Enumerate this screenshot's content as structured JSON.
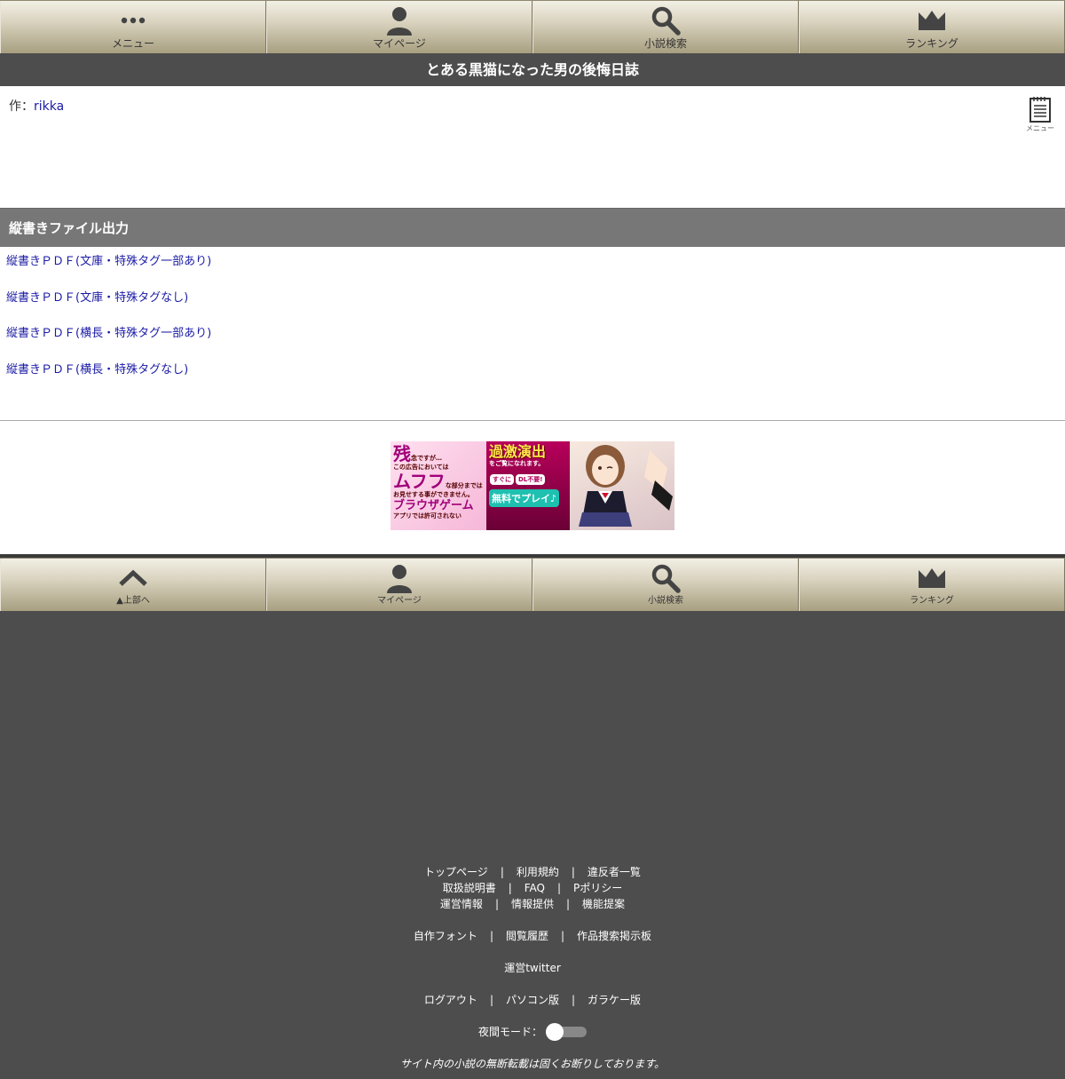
{
  "top_nav": [
    {
      "label": "メニュー",
      "icon": "dots-icon"
    },
    {
      "label": "マイページ",
      "icon": "user-icon"
    },
    {
      "label": "小説検索",
      "icon": "search-icon"
    },
    {
      "label": "ランキング",
      "icon": "crown-icon"
    }
  ],
  "title": "とある黒猫になった男の後悔日誌",
  "author": {
    "prefix": "作：",
    "name": "rikka"
  },
  "menu_button": {
    "label": "メニュー"
  },
  "section_header": "縦書きファイル出力",
  "pdf_links": [
    "縦書きＰＤＦ(文庫・特殊タグ一部あり)",
    "縦書きＰＤＦ(文庫・特殊タグなし)",
    "縦書きＰＤＦ(横長・特殊タグ一部あり)",
    "縦書きＰＤＦ(横長・特殊タグなし)"
  ],
  "ad": {
    "left_big1": "残",
    "left_small1": "念ですが…",
    "left_small2": "この広告においては",
    "left_big2": "ムフフ",
    "left_small3": "な部分までは",
    "left_small4": "お見せする事ができません。",
    "left_big3": "ブラウザゲーム",
    "left_small5": "アプリでは許可されない",
    "mid_big": "過激演出",
    "mid_small": "をご覧になれます。",
    "mid_pill1": "すぐに",
    "mid_pill2": "DL不要!",
    "mid_green": "無料でプレイ♪"
  },
  "bottom_nav": [
    {
      "label": "▲上部へ",
      "icon": "chevron-up-icon"
    },
    {
      "label": "マイページ",
      "icon": "user-icon"
    },
    {
      "label": "小説検索",
      "icon": "search-icon"
    },
    {
      "label": "ランキング",
      "icon": "crown-icon"
    }
  ],
  "footer": {
    "row1": [
      "トップページ",
      "利用規約",
      "違反者一覧"
    ],
    "row2": [
      "取扱説明書",
      "FAQ",
      "Pポリシー"
    ],
    "row3": [
      "運営情報",
      "情報提供",
      "機能提案"
    ],
    "row4": [
      "自作フォント",
      "閲覧履歴",
      "作品捜索掲示板"
    ],
    "row5": [
      "運営twitter"
    ],
    "row6": [
      "ログアウト",
      "パソコン版",
      "ガラケー版"
    ],
    "night_mode_label": "夜間モード：",
    "night_mode_on": false,
    "copyright": "サイト内の小説の無断転載は固くお断りしております。"
  },
  "colors": {
    "nav_gradient_top": "#f2efe5",
    "nav_gradient_bottom": "#a89f80",
    "title_bg": "#4d4d4d",
    "section_bg": "#777777",
    "link": "#1a1aa6",
    "footer_bg": "#4d4d4d"
  }
}
